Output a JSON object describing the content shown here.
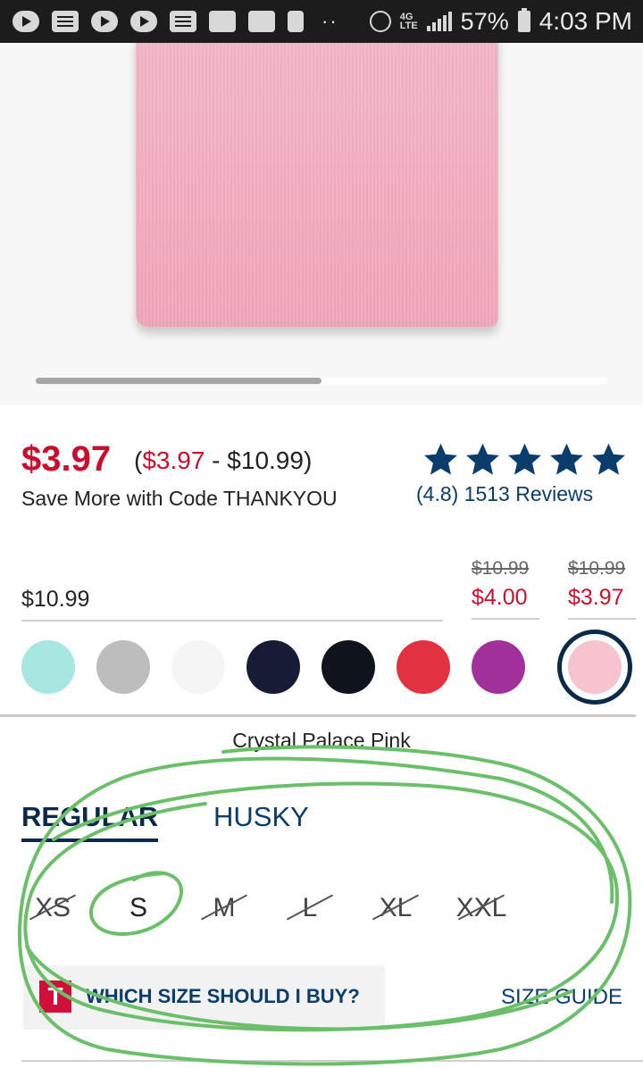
{
  "status_bar": {
    "battery_percent": "57%",
    "time": "4:03 PM",
    "network": "4G LTE",
    "icons": [
      "youtube-icon",
      "message-icon",
      "youtube-icon",
      "youtube-icon",
      "message-alert-icon",
      "voicemail-icon",
      "edit-icon",
      "battery-plus-icon",
      "more-dots-icon",
      "alarm-icon",
      "lte-icon",
      "signal-icon",
      "battery-icon"
    ]
  },
  "gallery": {
    "progress_fraction": 0.5
  },
  "price": {
    "current": "$3.97",
    "range_open": "(",
    "range_low": "$3.97",
    "range_sep": " - ",
    "range_high": "$10.99",
    "range_close": ")",
    "promo": "Save More with Code THANKYOU"
  },
  "rating": {
    "stars": 5,
    "summary": "(4.8) 1513 Reviews"
  },
  "price_options": {
    "base": "$10.99",
    "options": [
      {
        "old": "$10.99",
        "sale": "$4.00"
      },
      {
        "old": "$10.99",
        "sale": "$3.97"
      }
    ]
  },
  "swatches": [
    {
      "color": "#a8e6e2"
    },
    {
      "color": "#bdbdbd"
    },
    {
      "color": "#f5f5f5"
    },
    {
      "color": "#161c33"
    },
    {
      "color": "#0f141c"
    },
    {
      "color": "#e2323f"
    },
    {
      "color": "#a2309a"
    },
    {
      "color": "#f6c3cf",
      "selected": true
    }
  ],
  "color_name": "Crystal Palace Pink",
  "fit_tabs": {
    "active": "REGULAR",
    "inactive": "HUSKY"
  },
  "sizes": [
    {
      "label": "XS",
      "available": false
    },
    {
      "label": "S",
      "available": true
    },
    {
      "label": "M",
      "available": false
    },
    {
      "label": "L",
      "available": false
    },
    {
      "label": "XL",
      "available": false
    },
    {
      "label": "XXL",
      "available": false
    }
  ],
  "size_help": {
    "icon_letter": "T",
    "question": "WHICH SIZE SHOULD I BUY?",
    "guide_link": "SIZE GUIDE"
  },
  "colors": {
    "sale_red": "#c8102e",
    "navy": "#0b2a4a",
    "link_blue": "#0b3d6c",
    "annotation_green": "#6cbf6a"
  }
}
